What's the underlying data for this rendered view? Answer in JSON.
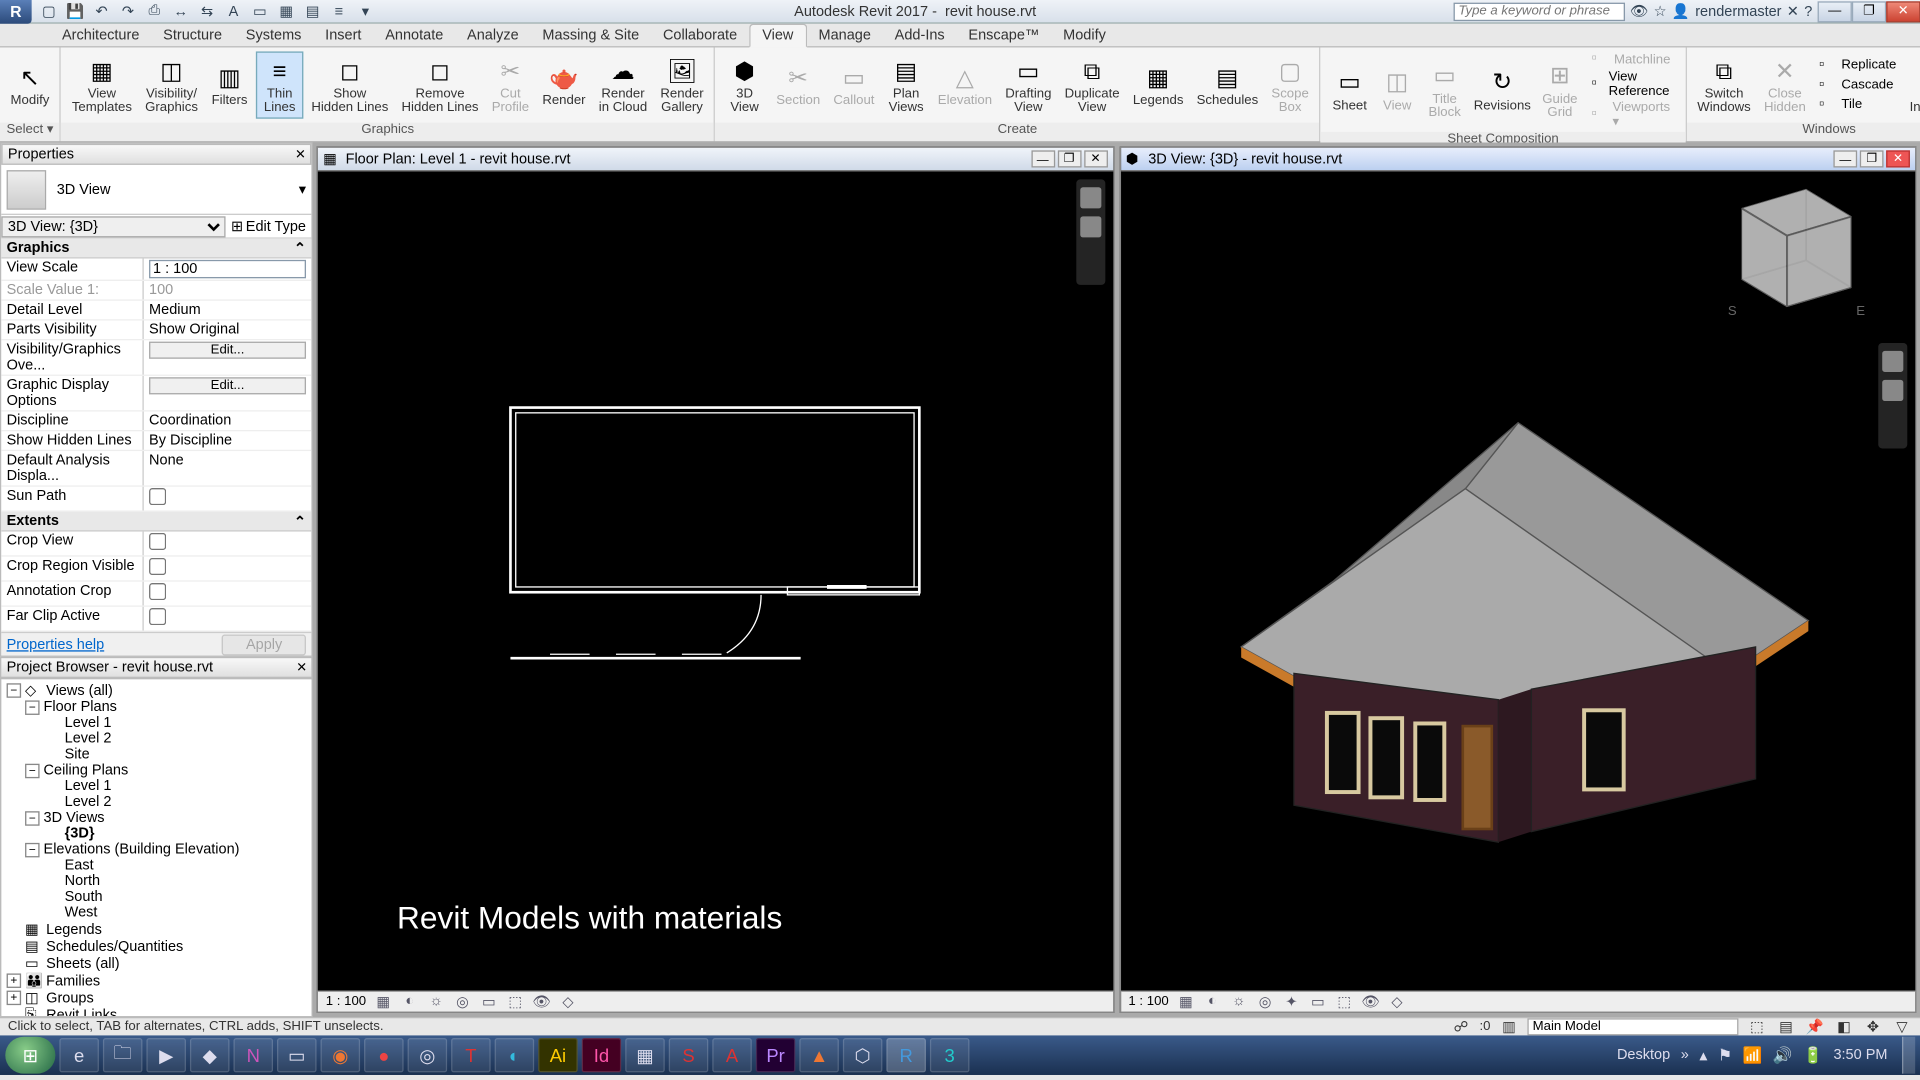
{
  "app": {
    "title_left": "Autodesk Revit 2017 -",
    "title_doc": "revit house.rvt",
    "search_placeholder": "Type a keyword or phrase",
    "username": "rendermaster"
  },
  "qat_icons": [
    "file-icon",
    "save-icon",
    "undo-icon",
    "redo-icon",
    "print-icon",
    "measure-icon",
    "align-icon",
    "text-icon",
    "dim-icon",
    "region-icon",
    "split-icon",
    "thinlines-icon",
    "dropdown-icon"
  ],
  "tabs": [
    "Architecture",
    "Structure",
    "Systems",
    "Insert",
    "Annotate",
    "Analyze",
    "Massing & Site",
    "Collaborate",
    "View",
    "Manage",
    "Add-Ins",
    "Enscape™",
    "Modify"
  ],
  "active_tab": "View",
  "ribbon": {
    "select": {
      "modify": "Modify",
      "select_lbl": "Select ▾"
    },
    "graphics": {
      "title": "Graphics",
      "items": [
        {
          "l1": "View",
          "l2": "Templates",
          "dis": false
        },
        {
          "l1": "Visibility/",
          "l2": "Graphics",
          "dis": false
        },
        {
          "l1": "Filters",
          "l2": "",
          "dis": false
        },
        {
          "l1": "Thin",
          "l2": "Lines",
          "dis": false,
          "active": true
        },
        {
          "l1": "Show",
          "l2": "Hidden Lines",
          "dis": false
        },
        {
          "l1": "Remove",
          "l2": "Hidden Lines",
          "dis": false
        },
        {
          "l1": "Cut",
          "l2": "Profile",
          "dis": true
        },
        {
          "l1": "Render",
          "l2": "",
          "dis": false
        },
        {
          "l1": "Render",
          "l2": "in Cloud",
          "dis": false
        },
        {
          "l1": "Render",
          "l2": "Gallery",
          "dis": false
        }
      ]
    },
    "create": {
      "title": "Create",
      "items": [
        {
          "l1": "3D",
          "l2": "View",
          "dis": false
        },
        {
          "l1": "Section",
          "l2": "",
          "dis": true
        },
        {
          "l1": "Callout",
          "l2": "",
          "dis": true
        },
        {
          "l1": "Plan",
          "l2": "Views",
          "dis": false
        },
        {
          "l1": "Elevation",
          "l2": "",
          "dis": true
        },
        {
          "l1": "Drafting",
          "l2": "View",
          "dis": false
        },
        {
          "l1": "Duplicate",
          "l2": "View",
          "dis": false
        },
        {
          "l1": "Legends",
          "l2": "",
          "dis": false
        },
        {
          "l1": "Schedules",
          "l2": "",
          "dis": false
        },
        {
          "l1": "Scope",
          "l2": "Box",
          "dis": true
        }
      ]
    },
    "sheetcomp": {
      "title": "Sheet Composition",
      "items": [
        {
          "l1": "Sheet",
          "l2": "",
          "dis": false
        },
        {
          "l1": "View",
          "l2": "",
          "dis": true
        },
        {
          "l1": "Title",
          "l2": "Block",
          "dis": true
        },
        {
          "l1": "Revisions",
          "l2": "",
          "dis": false
        },
        {
          "l1": "Guide",
          "l2": "Grid",
          "dis": true
        }
      ],
      "small": [
        {
          "t": "Matchline",
          "dis": true
        },
        {
          "t": "View Reference",
          "dis": false
        },
        {
          "t": "Viewports ▾",
          "dis": true
        }
      ]
    },
    "windows": {
      "title": "Windows",
      "switch": "Switch\nWindows",
      "close": "Close\nHidden",
      "ui": "User\nInterface",
      "small": [
        "Replicate",
        "Cascade",
        "Tile"
      ]
    }
  },
  "properties": {
    "title": "Properties",
    "type_name": "3D View",
    "instance_sel": "3D View: {3D}",
    "edit_type": "Edit Type",
    "groups": [
      {
        "name": "Graphics",
        "rows": [
          {
            "k": "View Scale",
            "v": "1 : 100",
            "input": true
          },
          {
            "k": "Scale Value   1:",
            "v": "100",
            "dim": true
          },
          {
            "k": "Detail Level",
            "v": "Medium"
          },
          {
            "k": "Parts Visibility",
            "v": "Show Original"
          },
          {
            "k": "Visibility/Graphics Ove...",
            "v": "Edit...",
            "btn": true
          },
          {
            "k": "Graphic Display Options",
            "v": "Edit...",
            "btn": true
          },
          {
            "k": "Discipline",
            "v": "Coordination"
          },
          {
            "k": "Show Hidden Lines",
            "v": "By Discipline"
          },
          {
            "k": "Default Analysis Displa...",
            "v": "None"
          },
          {
            "k": "Sun Path",
            "v": "",
            "check": true
          }
        ]
      },
      {
        "name": "Extents",
        "rows": [
          {
            "k": "Crop View",
            "v": "",
            "check": true
          },
          {
            "k": "Crop Region Visible",
            "v": "",
            "check": true
          },
          {
            "k": "Annotation Crop",
            "v": "",
            "check": true
          },
          {
            "k": "Far Clip Active",
            "v": "",
            "check": true
          }
        ]
      }
    ],
    "help": "Properties help",
    "apply": "Apply"
  },
  "browser": {
    "title": "Project Browser - revit house.rvt",
    "tree": [
      {
        "d": 0,
        "tw": "-",
        "ico": "◇",
        "t": "Views (all)"
      },
      {
        "d": 1,
        "tw": "-",
        "t": "Floor Plans"
      },
      {
        "d": 2,
        "t": "Level 1"
      },
      {
        "d": 2,
        "t": "Level 2"
      },
      {
        "d": 2,
        "t": "Site"
      },
      {
        "d": 1,
        "tw": "-",
        "t": "Ceiling Plans"
      },
      {
        "d": 2,
        "t": "Level 1"
      },
      {
        "d": 2,
        "t": "Level 2"
      },
      {
        "d": 1,
        "tw": "-",
        "t": "3D Views"
      },
      {
        "d": 2,
        "t": "{3D}",
        "bold": true
      },
      {
        "d": 1,
        "tw": "-",
        "t": "Elevations (Building Elevation)"
      },
      {
        "d": 2,
        "t": "East"
      },
      {
        "d": 2,
        "t": "North"
      },
      {
        "d": 2,
        "t": "South"
      },
      {
        "d": 2,
        "t": "West"
      },
      {
        "d": 0,
        "ico": "▦",
        "t": "Legends"
      },
      {
        "d": 0,
        "ico": "▤",
        "t": "Schedules/Quantities"
      },
      {
        "d": 0,
        "ico": "▭",
        "t": "Sheets (all)"
      },
      {
        "d": 0,
        "tw": "+",
        "ico": "👪",
        "t": "Families"
      },
      {
        "d": 0,
        "tw": "+",
        "ico": "◫",
        "t": "Groups"
      },
      {
        "d": 0,
        "ico": "⎘",
        "t": "Revit Links"
      }
    ]
  },
  "view_left": {
    "title": "Floor Plan: Level 1 - revit house.rvt",
    "scale": "1 : 100",
    "caption": "Revit Models with materials"
  },
  "view_right": {
    "title": "3D View: {3D} - revit house.rvt",
    "scale": "1 : 100"
  },
  "status": {
    "hint": "Click to select, TAB for alternates, CTRL adds, SHIFT unselects.",
    "sel": ":0",
    "main_model": "Main Model"
  },
  "taskbar": {
    "desktop_lbl": "Desktop",
    "time": "3:50 PM"
  }
}
